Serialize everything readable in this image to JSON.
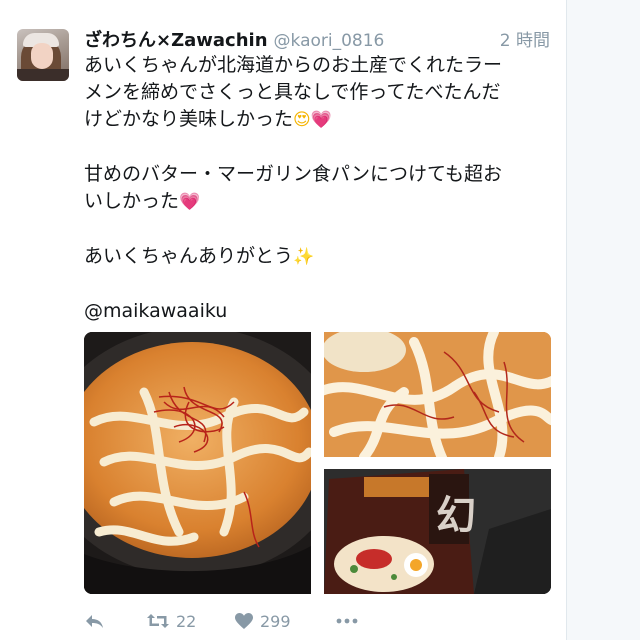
{
  "tweet": {
    "author": {
      "display_name": "ざわちん×Zawachin",
      "handle": "@kaori_0816",
      "avatar_icon": "profile-photo"
    },
    "timestamp": "2 時間",
    "text": {
      "line1": "あいくちゃんが北海道からのお土産でくれたラー",
      "line2": "メンを締めでさくっと具なしで作ってたべたんだ",
      "line3": "けどかなり美味しかった",
      "line3_emoji": "😍💗",
      "line4": "甘めのバター・マーガリン食パンにつけても超お",
      "line5": "いしかった",
      "line5_emoji": "💗",
      "line6": "あいくちゃんありがとう",
      "line6_emoji": "✨",
      "line7": "@maikawaaiku"
    },
    "media": [
      {
        "icon": "ramen-bowl-photo"
      },
      {
        "icon": "ramen-noodles-closeup-photo"
      },
      {
        "icon": "ramen-package-photo"
      }
    ],
    "actions": {
      "reply_icon": "reply-icon",
      "retweet_count": "22",
      "like_count": "299",
      "more_icon": "more-icon"
    }
  },
  "colors": {
    "text": "#14171a",
    "secondary_text": "#8899a6",
    "background": "#ffffff",
    "gutter": "#f5f8fa"
  }
}
